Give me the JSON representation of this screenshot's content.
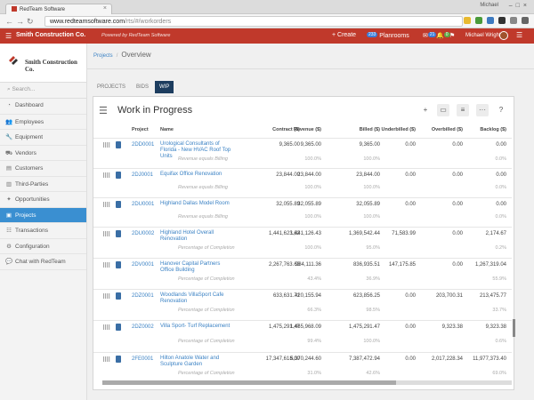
{
  "browser": {
    "tab_title": "RedTeam Software",
    "user_label": "Michael",
    "url_host": "www.redteamsoftware.com",
    "url_path": "/rts/#/workorders"
  },
  "appbar": {
    "company": "Smith Construction Co.",
    "powered": "Powered by RedTeam Software",
    "create": "+ Create",
    "planrooms": "Planrooms",
    "planroom_count": "233",
    "count_a": "21",
    "count_b": "0",
    "user": "Michael Wright"
  },
  "sidebar": {
    "logo_name": "Smith Construction Co.",
    "search_placeholder": "Search...",
    "items": [
      {
        "label": "Dashboard",
        "icon": "speedometer-icon"
      },
      {
        "label": "Employees",
        "icon": "people-icon"
      },
      {
        "label": "Equipment",
        "icon": "wrench-icon"
      },
      {
        "label": "Vendors",
        "icon": "truck-icon"
      },
      {
        "label": "Customers",
        "icon": "folder-icon"
      },
      {
        "label": "Third-Parties",
        "icon": "book-icon"
      },
      {
        "label": "Opportunities",
        "icon": "handshake-icon"
      },
      {
        "label": "Projects",
        "icon": "doc-icon"
      },
      {
        "label": "Transactions",
        "icon": "list-icon"
      },
      {
        "label": "Configuration",
        "icon": "gear-icon"
      },
      {
        "label": "Chat with RedTeam",
        "icon": "chat-icon"
      }
    ],
    "active_index": 7
  },
  "main": {
    "crumb": "Projects",
    "page_title": "Overview",
    "tabs": [
      "PROJECTS",
      "BIDS",
      "WIP"
    ],
    "active_tab": 2,
    "card_title": "Work in Progress",
    "columns": [
      "Project",
      "Name",
      "Contract ($)",
      "Revenue ($)",
      "Billed ($)",
      "Underbilled ($)",
      "Overbilled ($)",
      "Backlog ($)"
    ],
    "rows": [
      {
        "project": "2DD0001",
        "name": "Urological Consultants of Florida - New HVAC Roof Top Units",
        "contract": "9,365.00",
        "revenue": "9,365.00",
        "billed": "9,365.00",
        "under": "0.00",
        "over": "0.00",
        "backlog": "0.00",
        "sub": "Revenue equals Billing",
        "p_rev": "100.0%",
        "p_billed": "100.0%",
        "p_backlog": "0.0%"
      },
      {
        "project": "2DJ0001",
        "name": "Equifax Office Renovation",
        "contract": "23,844.00",
        "revenue": "23,844.00",
        "billed": "23,844.00",
        "under": "0.00",
        "over": "0.00",
        "backlog": "0.00",
        "sub": "Revenue equals Billing",
        "p_rev": "100.0%",
        "p_billed": "100.0%",
        "p_backlog": "0.0%"
      },
      {
        "project": "2DU0001",
        "name": "Highland Dallas Model Room",
        "contract": "32,055.89",
        "revenue": "32,055.89",
        "billed": "32,055.89",
        "under": "0.00",
        "over": "0.00",
        "backlog": "0.00",
        "sub": "Revenue equals Billing",
        "p_rev": "100.0%",
        "p_billed": "100.0%",
        "p_backlog": "0.0%"
      },
      {
        "project": "2DU0002",
        "name": "Highland Hotel Overall Renovation",
        "contract": "1,441,623.62",
        "revenue": "1,441,126.43",
        "billed": "1,369,542.44",
        "under": "71,583.99",
        "over": "0.00",
        "backlog": "2,174.67",
        "sub": "Percentage of Completion",
        "p_rev": "100.0%",
        "p_billed": "95.0%",
        "p_backlog": "0.2%"
      },
      {
        "project": "2DV0001",
        "name": "Hanover Capital Partners Office Building",
        "contract": "2,267,763.63",
        "revenue": "984,111.36",
        "billed": "836,935.51",
        "under": "147,175.85",
        "over": "0.00",
        "backlog": "1,267,319.04",
        "sub": "Percentage of Completion",
        "p_rev": "43.4%",
        "p_billed": "36.9%",
        "p_backlog": "55.9%"
      },
      {
        "project": "2DZ0001",
        "name": "Woodlands VillaSport Cafe Renovation",
        "contract": "633,631.71",
        "revenue": "420,155.94",
        "billed": "623,856.25",
        "under": "0.00",
        "over": "203,700.31",
        "backlog": "213,475.77",
        "sub": "Percentage of Completion",
        "p_rev": "66.3%",
        "p_billed": "98.5%",
        "p_backlog": "33.7%"
      },
      {
        "project": "2DZ0002",
        "name": "Villa Sport- Turf Replacement",
        "contract": "1,475,291.47",
        "revenue": "1,465,968.09",
        "billed": "1,475,291.47",
        "under": "0.00",
        "over": "9,323.38",
        "backlog": "9,323.38",
        "sub": "Percentage of Completion",
        "p_rev": "99.4%",
        "p_billed": "100.0%",
        "p_backlog": "0.6%"
      },
      {
        "project": "2FE0001",
        "name": "Hilton Anatole Water and Sculpture Garden",
        "contract": "17,347,618.00",
        "revenue": "5,370,244.60",
        "billed": "7,387,472.94",
        "under": "0.00",
        "over": "2,017,228.34",
        "backlog": "11,977,373.40",
        "sub": "Percentage of Completion",
        "p_rev": "31.0%",
        "p_billed": "42.6%",
        "p_backlog": "69.0%"
      }
    ]
  }
}
